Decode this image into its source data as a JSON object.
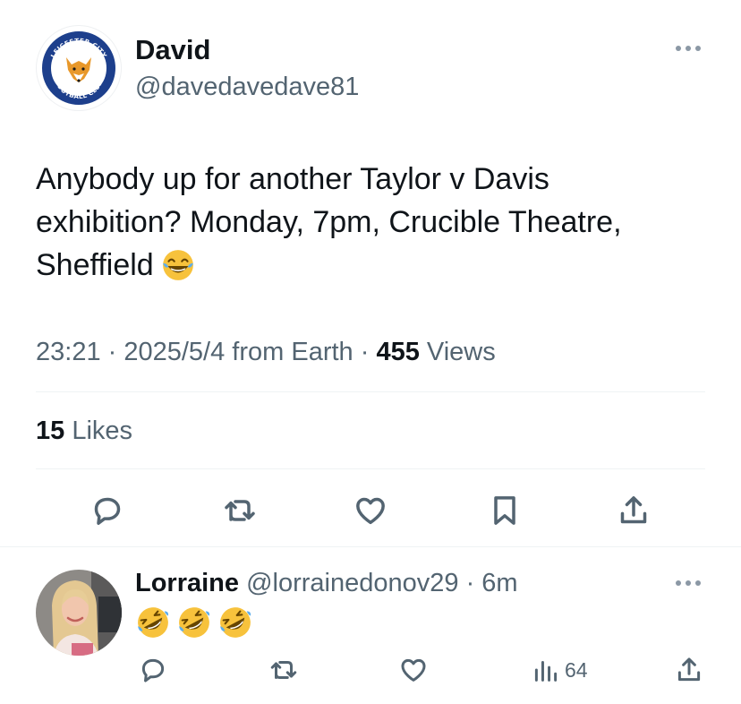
{
  "tweet": {
    "author": {
      "name": "David",
      "handle": "@davedavedave81",
      "avatar_icon": "leicester-city-crest-icon",
      "avatar_text_top": "LEICESTER CITY",
      "avatar_text_bottom": "FOOTBALL CLUB"
    },
    "text": "Anybody up for another Taylor v Davis\nexhibition? Monday, 7pm, Crucible Theatre,\nSheffield",
    "text_emoji": "face-with-tears-of-joy-icon",
    "time": "23:21",
    "sep1": " · ",
    "date_source": "2025/5/4 from Earth",
    "sep2": " · ",
    "views_count": "455",
    "views_label": " Views",
    "likes_count": "15",
    "likes_label": " Likes",
    "actions": [
      "reply-icon",
      "retweet-icon",
      "like-icon",
      "bookmark-icon",
      "share-icon"
    ]
  },
  "reply": {
    "name": "Lorraine",
    "handle": " @lorrainedonov29",
    "sep": " · ",
    "time": "6m",
    "emoji": [
      "rolling-on-floor-laughing-icon",
      "rolling-on-floor-laughing-icon",
      "rolling-on-floor-laughing-icon"
    ],
    "views_count": "64",
    "actions": [
      "reply-icon",
      "retweet-icon",
      "like-icon",
      "views-icon",
      "share-icon"
    ]
  },
  "colors": {
    "text": "#0f1419",
    "secondary": "#536471",
    "divider": "#eff3f4",
    "crest_blue": "#1d3f8c",
    "emoji_yellow": "#f7c23c"
  }
}
